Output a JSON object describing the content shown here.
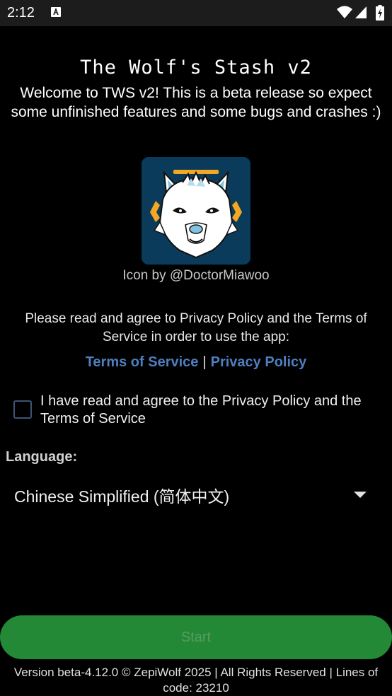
{
  "status_bar": {
    "time": "2:12",
    "icons": [
      "notification-icon",
      "wifi-icon",
      "signal-icon",
      "battery-icon"
    ]
  },
  "header": {
    "title": "The Wolf's Stash v2",
    "welcome": "Welcome to TWS v2! This is a beta release so expect some unfinished features and some bugs and crashes :)"
  },
  "icon": {
    "credit": "Icon by @DoctorMiawoo",
    "background_color": "#0b3b5a",
    "accent_color": "#f5a623"
  },
  "agreement": {
    "prompt": "Please read and agree to Privacy Policy and the Terms of Service in order to use the app:",
    "terms_link": "Terms of Service",
    "separator": "|",
    "privacy_link": "Privacy Policy",
    "checkbox_label": "I have read and agree to the Privacy Policy and the Terms of Service",
    "checked": false
  },
  "language": {
    "label": "Language:",
    "selected": "Chinese Simplified (简体中文)"
  },
  "start_button": {
    "label": "Start",
    "enabled": false,
    "color": "#238936"
  },
  "footer": {
    "text": "Version beta-4.12.0 © ZepiWolf 2025 | All Rights Reserved | Lines of code: 23210"
  },
  "colors": {
    "background": "#000000",
    "link": "#4e7fc0",
    "status_bar": "#1c1c1c"
  }
}
